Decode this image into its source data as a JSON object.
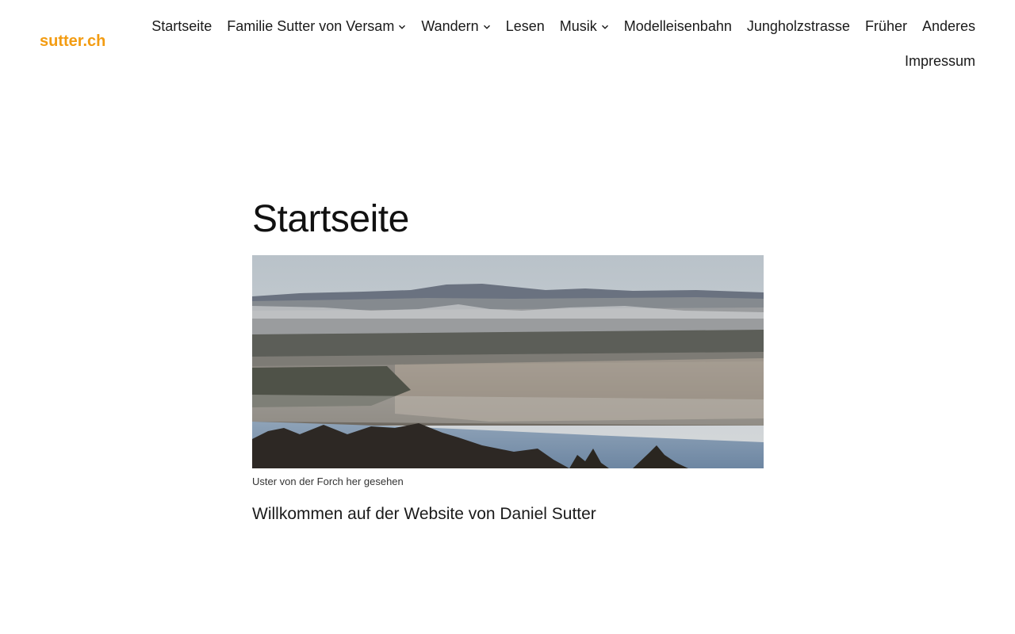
{
  "site": {
    "logo": "sutter.ch",
    "accent_color": "#f39c12"
  },
  "nav": {
    "row1": [
      {
        "label": "Startseite",
        "has_submenu": false
      },
      {
        "label": "Familie Sutter von Versam",
        "has_submenu": true
      },
      {
        "label": "Wandern",
        "has_submenu": true
      },
      {
        "label": "Lesen",
        "has_submenu": false
      },
      {
        "label": "Musik",
        "has_submenu": true
      },
      {
        "label": "Modelleisenbahn",
        "has_submenu": false
      },
      {
        "label": "Jungholzstrasse",
        "has_submenu": false
      },
      {
        "label": "Früher",
        "has_submenu": false
      },
      {
        "label": "Anderes",
        "has_submenu": false
      }
    ],
    "row2": [
      {
        "label": "Impressum",
        "has_submenu": false
      }
    ]
  },
  "main": {
    "title": "Startseite",
    "image_caption": "Uster von der Forch her gesehen",
    "welcome": "Willkommen auf der Website von Daniel Sutter"
  }
}
